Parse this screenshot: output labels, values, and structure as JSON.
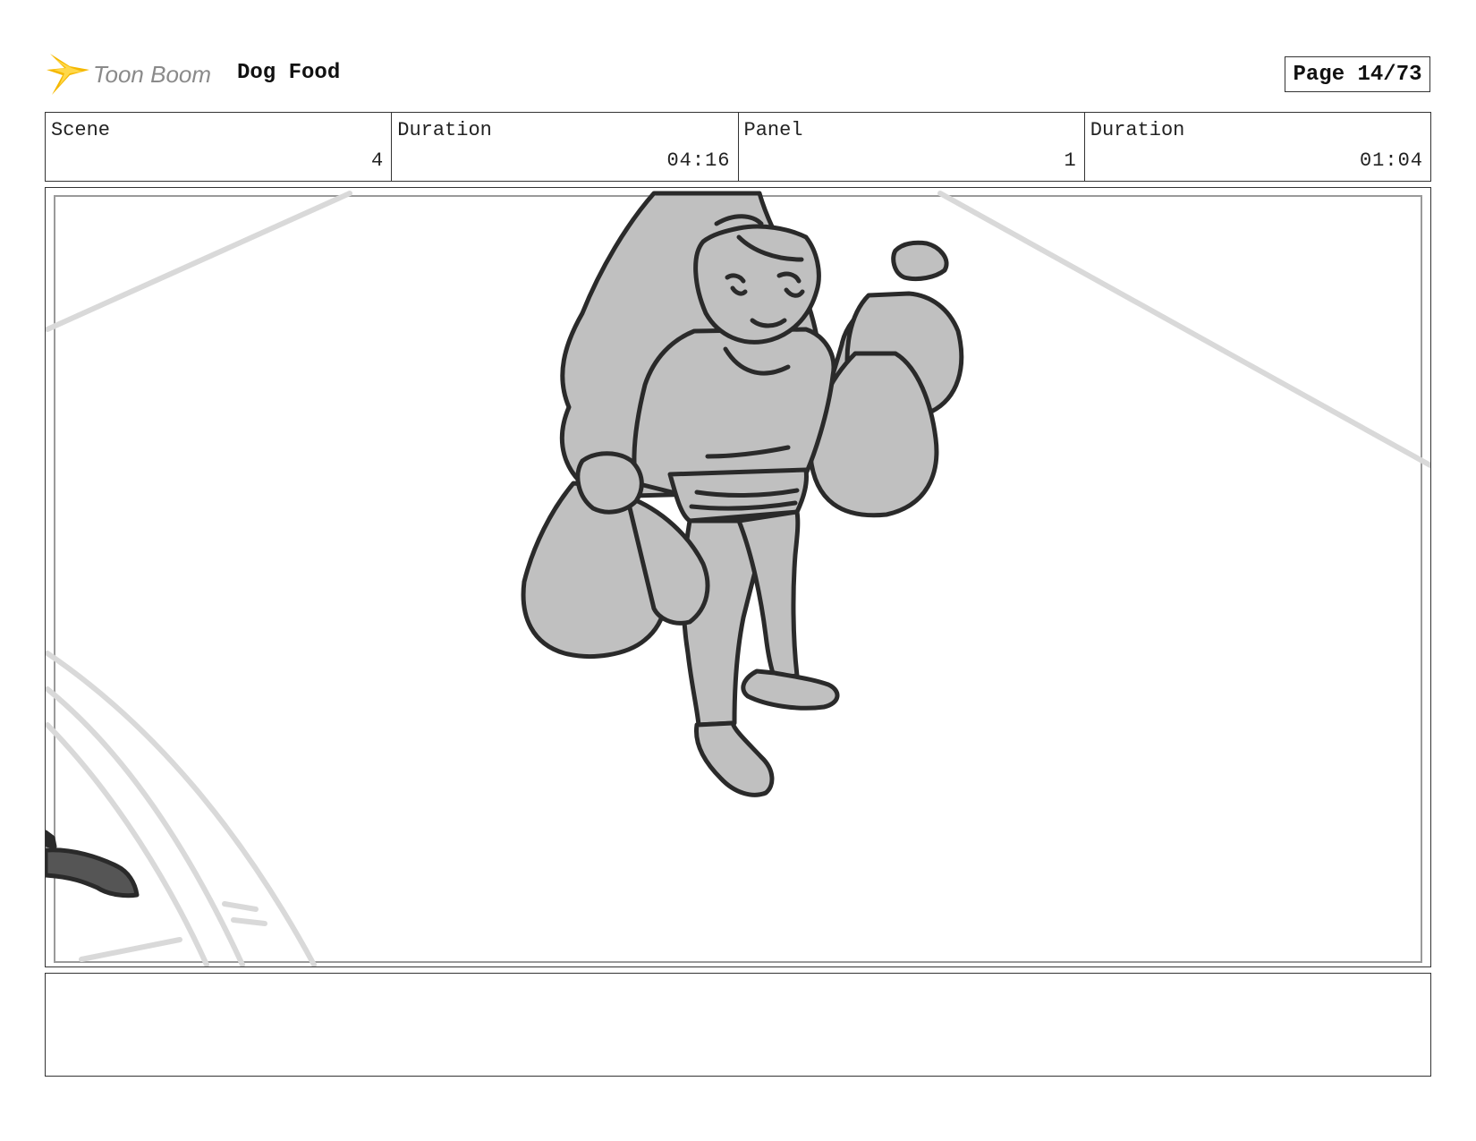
{
  "header": {
    "logo_text": "Toon Boom",
    "project_title": "Dog Food",
    "page_label": "Page 14/73"
  },
  "info": {
    "scene_label": "Scene",
    "scene_value": "4",
    "scene_duration_label": "Duration",
    "scene_duration_value": "04:16",
    "panel_label": "Panel",
    "panel_value": "1",
    "panel_duration_label": "Duration",
    "panel_duration_value": "01:04"
  },
  "colors": {
    "logo_orange": "#f5b800",
    "logo_text_gray": "#8a8a8a",
    "sketch_fill": "#c0c0c0",
    "sketch_line": "#2a2a2a",
    "guide_line": "#d9d9d9"
  },
  "notes": {
    "text": ""
  }
}
